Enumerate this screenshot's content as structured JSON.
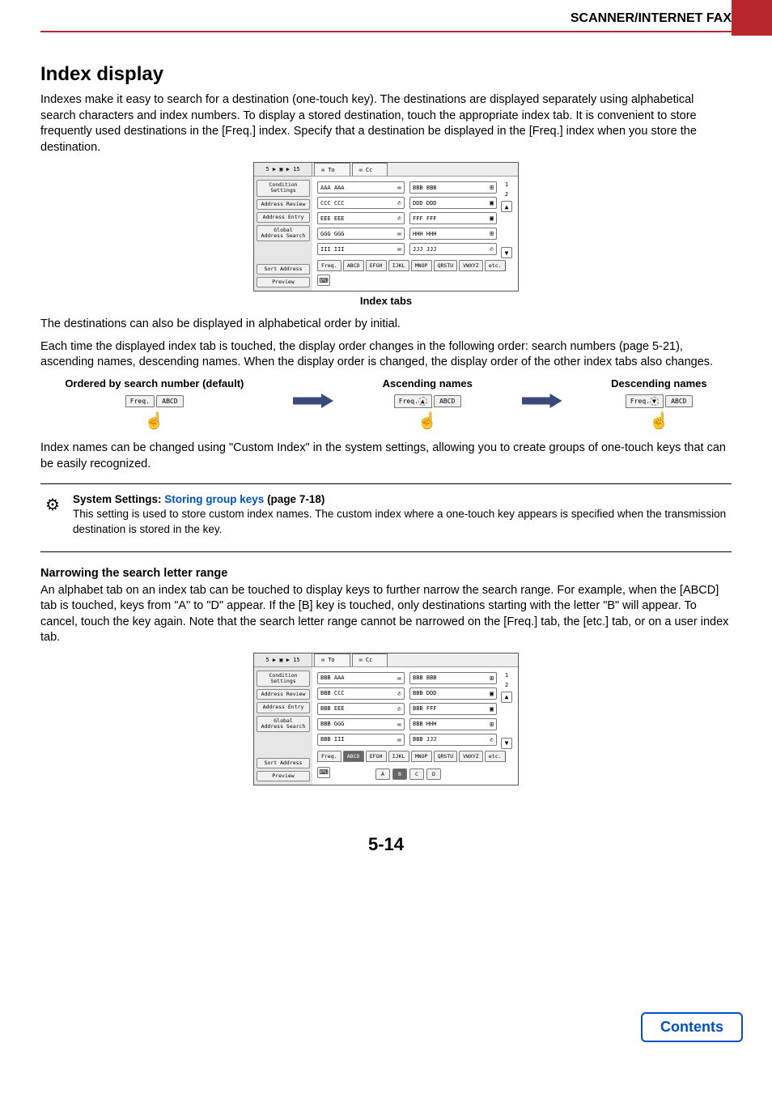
{
  "header": {
    "section": "SCANNER/INTERNET FAX"
  },
  "title": "Index display",
  "intro": "Indexes make it easy to search for a destination (one-touch key). The destinations are displayed separately using alphabetical search characters and index numbers. To display a stored destination, touch the appropriate index tab. It is convenient to store frequently used destinations in the [Freq.] index. Specify that a destination be displayed in the [Freq.] index when you store the destination.",
  "screen1": {
    "corner": "5 ▶ ▣ ▶ 15",
    "top_tabs": [
      "To",
      "Cc"
    ],
    "side": [
      "Condition\nSettings",
      "Address Review",
      "Address Entry",
      "Global\nAddress Search",
      "Sort Address",
      "Preview"
    ],
    "dests": [
      [
        "AAA AAA",
        "BBB BBB"
      ],
      [
        "CCC CCC",
        "DDD DDD"
      ],
      [
        "EEE EEE",
        "FFF FFF"
      ],
      [
        "GGG GGG",
        "HHH HHH"
      ],
      [
        "III III",
        "JJJ JJJ"
      ]
    ],
    "pages": [
      "1",
      "2"
    ],
    "index_tabs": [
      "Freq.",
      "ABCD",
      "EFGH",
      "IJKL",
      "MNOP",
      "QRSTU",
      "VWXYZ",
      "etc."
    ]
  },
  "caption_tabs": "Index tabs",
  "para2a": "The destinations can also be displayed in alphabetical order by initial.",
  "para2b": "Each time the displayed index tab is touched, the display order changes in the following order: search numbers (page 5-21), ascending names, descending names. When the display order is changed, the display order of the other index tabs also changes.",
  "cols": {
    "h1": "Ordered by search number (default)",
    "h2": "Ascending names",
    "h3": "Descending names",
    "freq": "Freq.",
    "abcd": "ABCD"
  },
  "para3": "Index names can be changed using \"Custom Index\" in the system settings, allowing you to create groups of one-touch keys that can be easily recognized.",
  "note": {
    "hdr_a": "System Settings: ",
    "hdr_link": "Storing group keys",
    "hdr_b": " (page 7-18)",
    "body": "This setting is used to store custom index names. The custom index where a one-touch key appears is specified when the transmission destination is stored in the key."
  },
  "narrow": {
    "head": "Narrowing the search letter range",
    "body": "An alphabet tab on an index tab can be touched to display keys to further narrow the search range. For example, when the [ABCD] tab is touched, keys from \"A\" to \"D\" appear. If the [B] key is touched, only destinations starting with the letter \"B\" will appear. To cancel, touch the key again. Note that the search letter range cannot be narrowed on the [Freq.] tab, the [etc.] tab, or on a user index tab."
  },
  "screen2": {
    "corner": "5 ▶ ▣ ▶ 15",
    "top_tabs": [
      "To",
      "Cc"
    ],
    "side": [
      "Condition\nSettings",
      "Address Review",
      "Address Entry",
      "Global\nAddress Search",
      "Sort Address",
      "Preview"
    ],
    "dests": [
      [
        "BBB AAA",
        "BBB BBB"
      ],
      [
        "BBB CCC",
        "BBB DDD"
      ],
      [
        "BBB EEE",
        "BBB FFF"
      ],
      [
        "BBB GGG",
        "BBB HHH"
      ],
      [
        "BBB III",
        "BBB JJJ"
      ]
    ],
    "pages": [
      "1",
      "2"
    ],
    "index_tabs": [
      "Freq.",
      "ABCD",
      "EFGH",
      "IJKL",
      "MNOP",
      "QRSTU",
      "VWXYZ",
      "etc."
    ],
    "letters": [
      "A",
      "B",
      "C",
      "D"
    ]
  },
  "page_num": "5-14",
  "contents": "Contents"
}
